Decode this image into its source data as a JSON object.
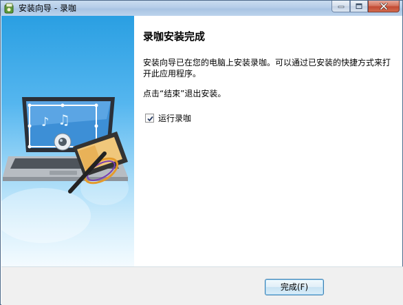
{
  "window": {
    "title": "安装向导 - 录咖",
    "controls": {
      "minimize": "minimize",
      "maximize": "maximize",
      "close": "close"
    }
  },
  "content": {
    "heading": "录咖安装完成",
    "description": "安装向导已在您的电脑上安装录咖。可以通过已安装的快捷方式来打开此应用程序。",
    "hint": "点击“结束”退出安装。",
    "run_checkbox": {
      "label": "运行录咖",
      "checked": true
    }
  },
  "footer": {
    "finish_label": "完成(F)"
  },
  "colors": {
    "accent": "#2a9fe2",
    "button_border": "#3c7fb1",
    "close": "#c24a33"
  },
  "icons": [
    "app-installer-icon",
    "minimize-icon",
    "maximize-icon",
    "close-icon",
    "check-icon",
    "laptop-illustration",
    "film-reel-illustration"
  ]
}
